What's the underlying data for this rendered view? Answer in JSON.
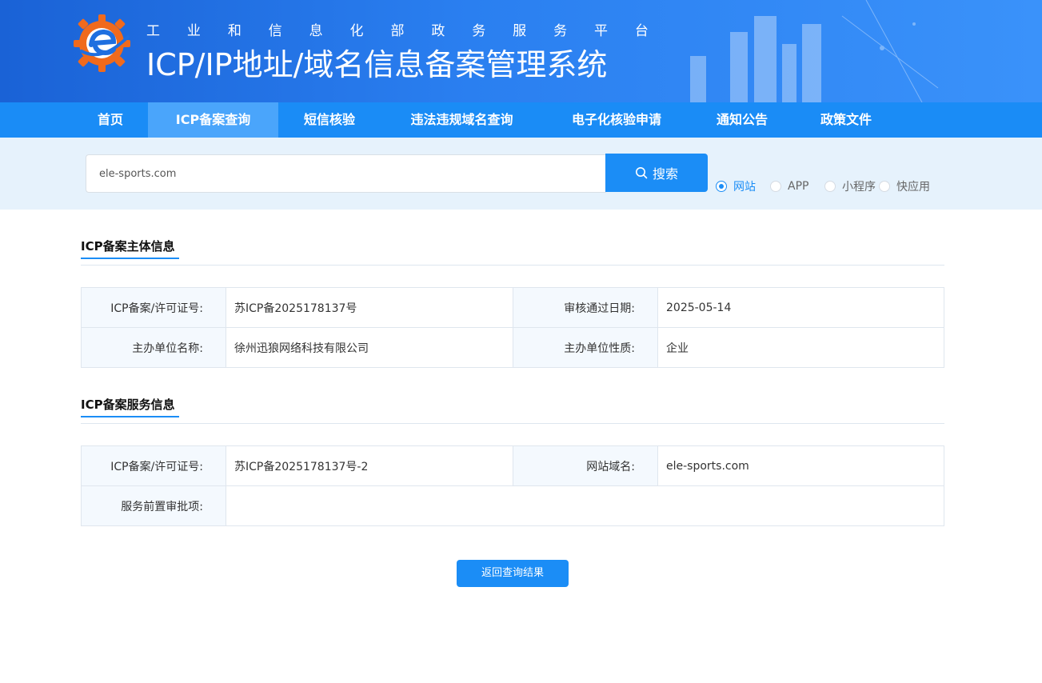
{
  "header": {
    "subtitle_chars": [
      "工",
      "业",
      "和",
      "信",
      "息",
      "化",
      "部",
      "政",
      "务",
      "服",
      "务",
      "平",
      "台"
    ],
    "title": "ICP/IP地址/域名信息备案管理系统",
    "logo_icon": "gear-e-logo-icon"
  },
  "nav": {
    "items": [
      {
        "label": "首页",
        "active": false
      },
      {
        "label": "ICP备案查询",
        "active": true
      },
      {
        "label": "短信核验",
        "active": false
      },
      {
        "label": "违法违规域名查询",
        "active": false
      },
      {
        "label": "电子化核验申请",
        "active": false
      },
      {
        "label": "通知公告",
        "active": false
      },
      {
        "label": "政策文件",
        "active": false
      }
    ]
  },
  "search": {
    "value": "ele-sports.com",
    "button_label": "搜索",
    "button_icon": "search-icon",
    "types": [
      {
        "label": "网站",
        "checked": true
      },
      {
        "label": "APP",
        "checked": false
      },
      {
        "label": "小程序",
        "checked": false
      },
      {
        "label": "快应用",
        "checked": false
      }
    ]
  },
  "subject": {
    "title": "ICP备案主体信息",
    "license_label": "ICP备案/许可证号:",
    "license_value": "苏ICP备2025178137号",
    "approve_date_label": "审核通过日期:",
    "approve_date_value": "2025-05-14",
    "org_name_label": "主办单位名称:",
    "org_name_value": "徐州迅狼网络科技有限公司",
    "org_type_label": "主办单位性质:",
    "org_type_value": "企业"
  },
  "service": {
    "title": "ICP备案服务信息",
    "license_label": "ICP备案/许可证号:",
    "license_value": "苏ICP备2025178137号-2",
    "domain_label": "网站域名:",
    "domain_value": "ele-sports.com",
    "preapproval_label": "服务前置审批项:",
    "preapproval_value": ""
  },
  "back_button_label": "返回查询结果",
  "colors": {
    "primary": "#1b8df6",
    "nav_bg": "#1a8cf6",
    "nav_active": "#4aa5fb",
    "search_band": "#e6f2fc",
    "label_cell": "#f4f9fe"
  }
}
